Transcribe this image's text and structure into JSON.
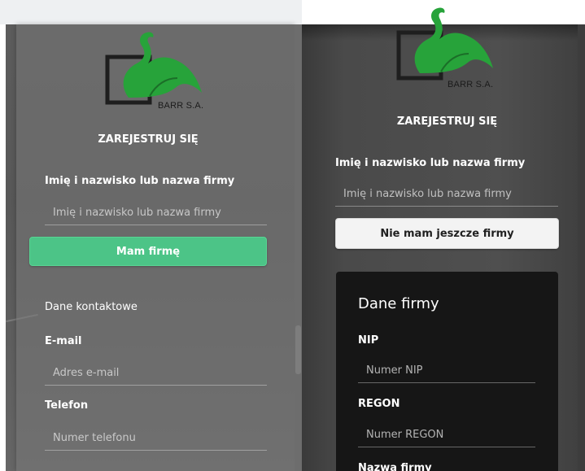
{
  "colors": {
    "accent_green": "#4cc487",
    "logo_green": "#27a33a",
    "firm_box": "#161616"
  },
  "logo": {
    "caption": "BARR S.A.",
    "icon": "swan-logo-icon"
  },
  "left": {
    "heading": "ZAREJESTRUJ SIĘ",
    "name_label": "Imię i nazwisko lub nazwa firmy",
    "name_placeholder": "Imię i nazwisko lub nazwa firmy",
    "company_toggle_label": "Mam firmę",
    "contact_section": "Dane kontaktowe",
    "email_label": "E-mail",
    "email_placeholder": "Adres e-mail",
    "phone_label": "Telefon",
    "phone_placeholder": "Numer telefonu"
  },
  "right": {
    "heading": "ZAREJESTRUJ SIĘ",
    "name_label": "Imię i nazwisko lub nazwa firmy",
    "name_placeholder": "Imię i nazwisko lub nazwa firmy",
    "no_company_label": "Nie mam jeszcze firmy",
    "company_section": {
      "title": "Dane firmy",
      "nip_label": "NIP",
      "nip_placeholder": "Numer NIP",
      "regon_label": "REGON",
      "regon_placeholder": "Numer REGON",
      "company_name_label": "Nazwa firmy"
    }
  }
}
